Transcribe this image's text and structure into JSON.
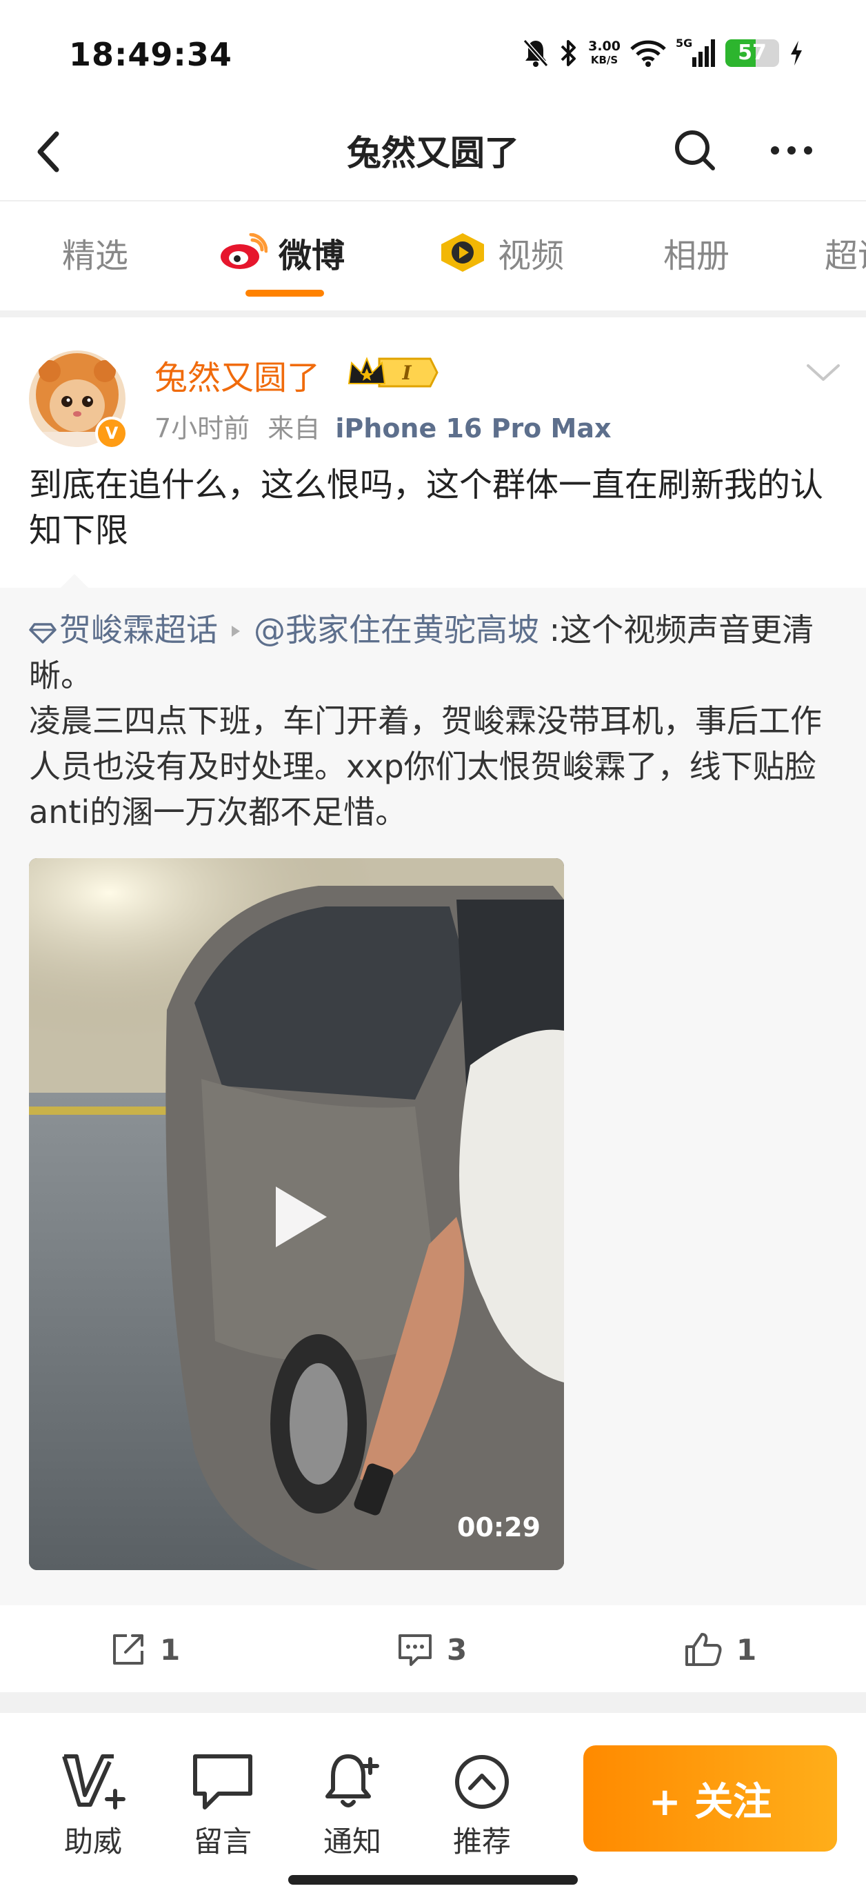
{
  "status_bar": {
    "time": "18:49:34",
    "net_speed_value": "3.00",
    "net_speed_unit": "KB/S",
    "network": "5G",
    "battery_level": "57",
    "battery_fraction": 0.57
  },
  "header": {
    "title": "兔然又圆了"
  },
  "tabs": [
    {
      "label": "精选"
    },
    {
      "label": "微博"
    },
    {
      "label": "视频"
    },
    {
      "label": "相册"
    },
    {
      "label": "超话"
    }
  ],
  "post": {
    "author": "兔然又圆了",
    "vip_level": "I",
    "time_ago": "7小时前",
    "from_prefix": "来自",
    "device": "iPhone 16 Pro Max",
    "text": "到底在追什么，这么恨吗，这个群体一直在刷新我的认知下限"
  },
  "repost": {
    "supertopic": "贺峻霖超话",
    "mention": "@我家住在黄驼高坡",
    "text_line1": ":这个视频声音更清晰。",
    "text_body": "凌晨三四点下班，车门开着，贺峻霖没带耳机，事后工作人员也没有及时处理。xxp你们太恨贺峻霖了，线下贴脸anti的溷一万次都不足惜。",
    "video_duration": "00:29"
  },
  "actions": {
    "repost_count": "1",
    "comment_count": "3",
    "like_count": "1"
  },
  "toolbar": {
    "items": [
      {
        "label": "助威"
      },
      {
        "label": "留言"
      },
      {
        "label": "通知"
      },
      {
        "label": "推荐"
      }
    ],
    "follow_label": "+ 关注"
  },
  "colors": {
    "accent": "#ff8200",
    "author_name": "#f06b0c",
    "link": "#5d6f8c",
    "battery_green": "#2db52e"
  }
}
